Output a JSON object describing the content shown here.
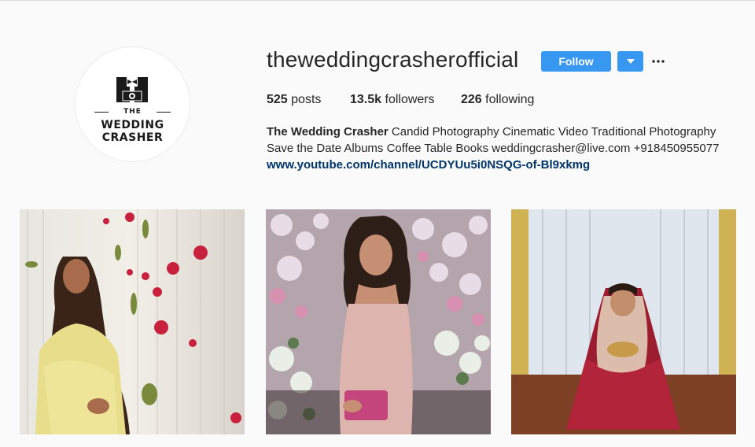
{
  "profile": {
    "username": "theweddingcrasherofficial",
    "follow_label": "Follow",
    "avatar_logo": {
      "line1": "THE",
      "line2": "WEDDING",
      "line3": "CRASHER"
    },
    "stats": {
      "posts_count": "525",
      "posts_label": "posts",
      "followers_count": "13.5k",
      "followers_label": "followers",
      "following_count": "226",
      "following_label": "following"
    },
    "bio": {
      "name": "The Wedding Crasher",
      "line1_rest": " Candid Photography Cinematic Video Traditional Photography",
      "line2": "Save the Date Albums Coffee Table Books weddingcrasher@live.com +918450955077",
      "link": "www.youtube.com/channel/UCDYUu5i0NSQG-of-Bl9xkmg"
    }
  },
  "colors": {
    "accent": "#3897f0",
    "link": "#003569",
    "background": "#fafafa"
  },
  "icons": {
    "dropdown": "caret-down-icon",
    "more": "more-options-icon"
  },
  "posts": [
    {
      "subject": "woman in yellow outfit with floral strings"
    },
    {
      "subject": "woman in pink sequin dress with flowers"
    },
    {
      "subject": "bride in red lehenga by window"
    }
  ]
}
